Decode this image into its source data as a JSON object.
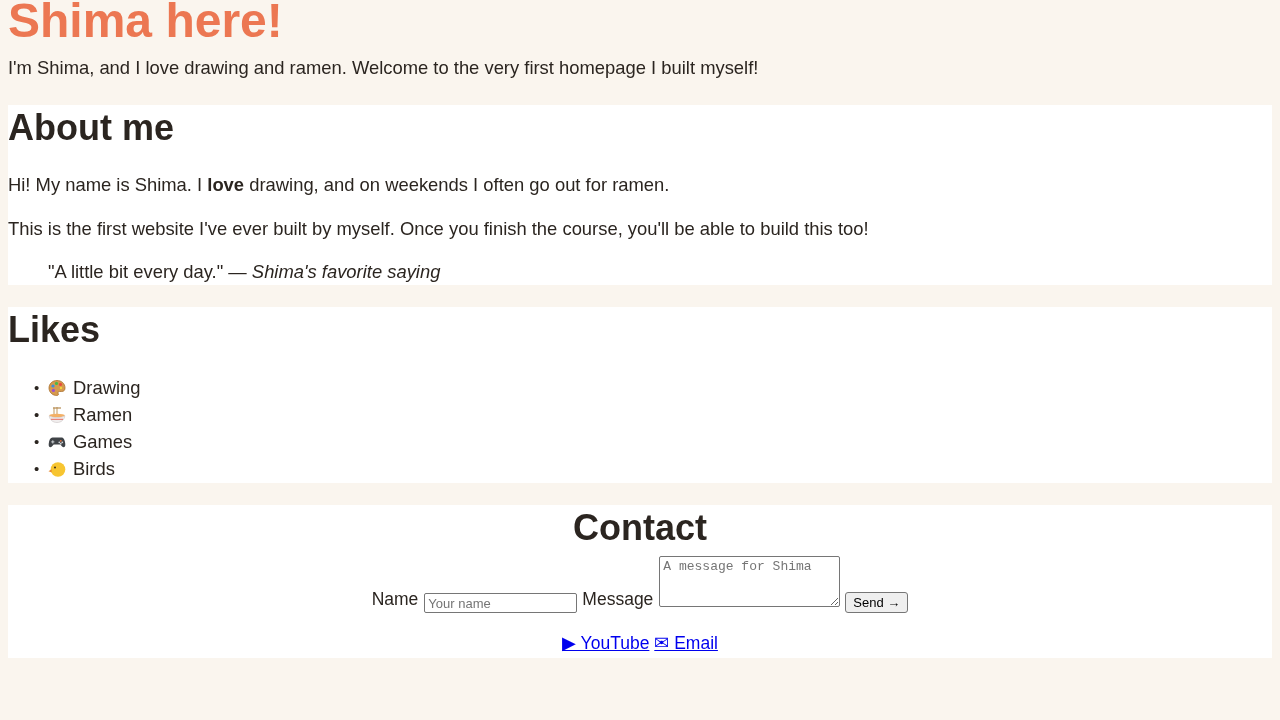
{
  "header": {
    "title": "Shima here!",
    "intro": "I'm Shima, and I love drawing and ramen. Welcome to the very first homepage I built myself!"
  },
  "about": {
    "heading": "About me",
    "paragraphs": [
      "Hi! My name is Shima. I **love** drawing, and on weekends I often go out for ramen.",
      "This is the first website I've ever built by myself. Once you finish the course, you'll be able to build this too!"
    ],
    "quote": "\"A little bit every day.\" — *Shima's favorite saying*"
  },
  "likes": {
    "heading": "Likes",
    "items": [
      {
        "bullet": "•",
        "kind": "palette",
        "label": "Drawing"
      },
      {
        "bullet": "•",
        "kind": "bowl",
        "label": "Ramen"
      },
      {
        "bullet": "•",
        "kind": "gamepad",
        "label": "Games"
      },
      {
        "bullet": "•",
        "kind": "chick",
        "label": "Birds"
      }
    ]
  },
  "contact": {
    "heading": "Contact",
    "fields": [
      {
        "kind": "input",
        "label": "Name",
        "placeholder": "Your name"
      },
      {
        "kind": "textarea",
        "label": "Message",
        "placeholder": "A message for Shima"
      }
    ],
    "submit": "Send →",
    "links": [
      {
        "label": "▶ YouTube"
      },
      {
        "label": "✉ Email"
      }
    ]
  }
}
